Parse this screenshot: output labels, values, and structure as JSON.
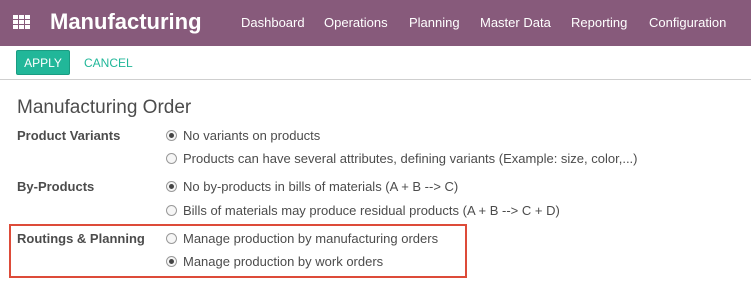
{
  "header": {
    "app_title": "Manufacturing",
    "menu": [
      "Dashboard",
      "Operations",
      "Planning",
      "Master Data",
      "Reporting",
      "Configuration"
    ],
    "colors": {
      "bar": "#875a7b",
      "accent": "#21b799",
      "highlight": "#dd4b39"
    }
  },
  "control": {
    "apply_label": "APPLY",
    "cancel_label": "CANCEL"
  },
  "section": {
    "title": "Manufacturing Order",
    "fields": [
      {
        "label": "Product Variants",
        "options": [
          {
            "text": "No variants on products",
            "checked": true
          },
          {
            "text": "Products can have several attributes, defining variants (Example: size, color,...)",
            "checked": false
          }
        ]
      },
      {
        "label": "By-Products",
        "options": [
          {
            "text": "No by-products in bills of materials (A + B --> C)",
            "checked": true
          },
          {
            "text": "Bills of materials may produce residual products (A + B --> C + D)",
            "checked": false
          }
        ]
      },
      {
        "label": "Routings & Planning",
        "options": [
          {
            "text": "Manage production by manufacturing orders",
            "checked": false
          },
          {
            "text": "Manage production by work orders",
            "checked": true
          }
        ]
      }
    ]
  }
}
